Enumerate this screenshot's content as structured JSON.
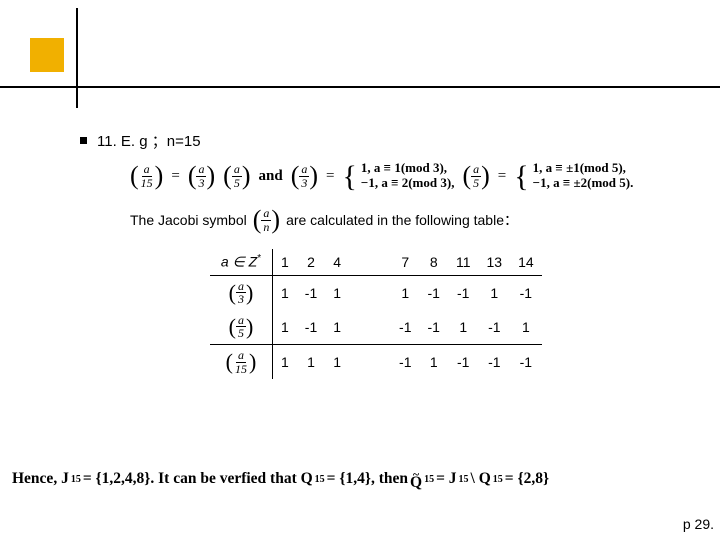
{
  "bullet_title": "11. E. g ；n=15",
  "jacobi_pre": "The Jacobi symbol",
  "jacobi_post": "are calculated in the following table：",
  "formula": {
    "lhs_num": "a",
    "lhs_den": "15",
    "f1_num": "a",
    "f1_den": "3",
    "f2_num": "a",
    "f2_den": "5",
    "and": "and",
    "case3_a": "1,  a ≡ 1(mod 3),",
    "case3_b": "−1,  a ≡ 2(mod 3),",
    "case5_a": "1,  a ≡ ±1(mod 5),",
    "case5_b": "−1,  a ≡ ±2(mod 5)."
  },
  "sym_num": "a",
  "sym_den": "n",
  "table": {
    "header_first": "a ∈",
    "z_star": "Z",
    "columns": [
      "1",
      "2",
      "4",
      "7",
      "8",
      "11",
      "13",
      "14"
    ],
    "rows": [
      {
        "label_num": "a",
        "label_den": "3",
        "vals": [
          "1",
          "-1",
          "1",
          "1",
          "-1",
          "-1",
          "1",
          "-1"
        ]
      },
      {
        "label_num": "a",
        "label_den": "5",
        "vals": [
          "1",
          "-1",
          "1",
          "-1",
          "-1",
          "1",
          "-1",
          "1"
        ]
      },
      {
        "label_num": "a",
        "label_den": "15",
        "vals": [
          "1",
          "1",
          "1",
          "-1",
          "1",
          "-1",
          "-1",
          "-1"
        ]
      }
    ]
  },
  "hence": {
    "p1": "Hence, J",
    "j_sub": "15",
    "p2": " = {1,2,4,8}. It can be verfied that Q",
    "q_sub": "15",
    "p3": " = {1,4}, then ",
    "qtilde": "Q",
    "qt_sub": "15",
    "p4": " = J",
    "p5": " \\ Q",
    "p6": " = {2,8}"
  },
  "footer": "p 29."
}
